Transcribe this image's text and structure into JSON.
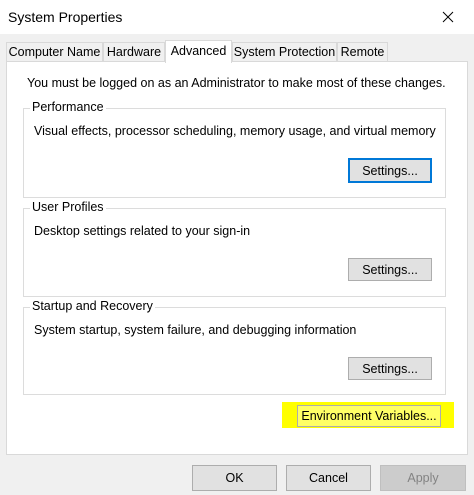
{
  "window": {
    "title": "System Properties",
    "close_glyph": "close-icon"
  },
  "tabs": [
    {
      "label": "Computer Name",
      "active": false
    },
    {
      "label": "Hardware",
      "active": false
    },
    {
      "label": "Advanced",
      "active": true
    },
    {
      "label": "System Protection",
      "active": false
    },
    {
      "label": "Remote",
      "active": false
    }
  ],
  "advanced": {
    "admin_message": "You must be logged on as an Administrator to make most of these changes.",
    "performance": {
      "title": "Performance",
      "description": "Visual effects, processor scheduling, memory usage, and virtual memory",
      "button": "Settings..."
    },
    "user_profiles": {
      "title": "User Profiles",
      "description": "Desktop settings related to your sign-in",
      "button": "Settings..."
    },
    "startup_recovery": {
      "title": "Startup and Recovery",
      "description": "System startup, system failure, and debugging information",
      "button": "Settings..."
    },
    "env_button": "Environment Variables..."
  },
  "footer": {
    "ok": "OK",
    "cancel": "Cancel",
    "apply": "Apply"
  },
  "colors": {
    "highlight": "#ffff00",
    "focus_border": "#0078d7",
    "button_face": "#e1e1e1"
  }
}
